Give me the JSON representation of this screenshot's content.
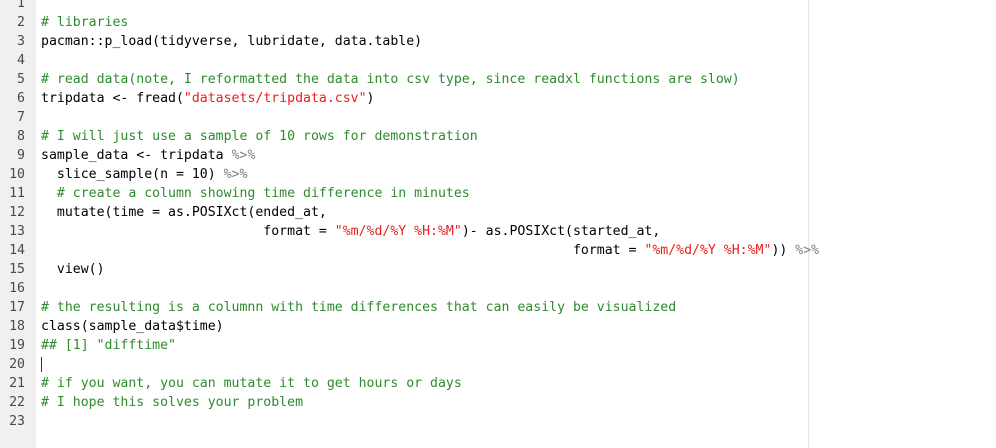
{
  "editor": {
    "language": "R",
    "colors": {
      "gutter_bg": "#f0f0f0",
      "comment": "#2e8b2e",
      "string": "#e8211c",
      "pipe": "#7f7f7f",
      "text": "#000000"
    },
    "lines": [
      {
        "n": "1",
        "tokens": []
      },
      {
        "n": "2",
        "tokens": [
          {
            "t": "# libraries",
            "c": "comment"
          }
        ]
      },
      {
        "n": "3",
        "tokens": [
          {
            "t": "pacman::p_load(tidyverse, lubridate, data.table)",
            "c": ""
          }
        ]
      },
      {
        "n": "4",
        "tokens": []
      },
      {
        "n": "5",
        "tokens": [
          {
            "t": "# read data(note, I reformatted the data into csv type, since readxl functions are slow)",
            "c": "comment"
          }
        ]
      },
      {
        "n": "6",
        "tokens": [
          {
            "t": "tripdata <- fread(",
            "c": ""
          },
          {
            "t": "\"datasets/tripdata.csv\"",
            "c": "str"
          },
          {
            "t": ")",
            "c": ""
          }
        ]
      },
      {
        "n": "7",
        "tokens": []
      },
      {
        "n": "8",
        "tokens": [
          {
            "t": "# I will just use a sample of 10 rows for demonstration",
            "c": "comment"
          }
        ]
      },
      {
        "n": "9",
        "tokens": [
          {
            "t": "sample_data <- tripdata ",
            "c": ""
          },
          {
            "t": "%>%",
            "c": "pipe"
          }
        ]
      },
      {
        "n": "10",
        "tokens": [
          {
            "t": "  slice_sample(n = 10) ",
            "c": ""
          },
          {
            "t": "%>%",
            "c": "pipe"
          }
        ]
      },
      {
        "n": "11",
        "tokens": [
          {
            "t": "  # create a column showing time difference in minutes",
            "c": "comment"
          }
        ]
      },
      {
        "n": "12",
        "tokens": [
          {
            "t": "  mutate(time = as.POSIXct(ended_at,",
            "c": ""
          }
        ]
      },
      {
        "n": "13",
        "tokens": [
          {
            "t": "                            format = ",
            "c": ""
          },
          {
            "t": "\"%m/%d/%Y %H:%M\"",
            "c": "str"
          },
          {
            "t": ")- as.POSIXct(started_at,",
            "c": ""
          }
        ]
      },
      {
        "n": "14",
        "tokens": [
          {
            "t": "                                                                   format = ",
            "c": ""
          },
          {
            "t": "\"%m/%d/%Y %H:%M\"",
            "c": "str"
          },
          {
            "t": ")) ",
            "c": ""
          },
          {
            "t": "%>%",
            "c": "pipe"
          }
        ]
      },
      {
        "n": "15",
        "tokens": [
          {
            "t": "  view()",
            "c": ""
          }
        ]
      },
      {
        "n": "16",
        "tokens": []
      },
      {
        "n": "17",
        "tokens": [
          {
            "t": "# the resulting is a columnn with time differences that can easily be visualized",
            "c": "comment"
          }
        ]
      },
      {
        "n": "18",
        "tokens": [
          {
            "t": "class(sample_data$time)",
            "c": ""
          }
        ]
      },
      {
        "n": "19",
        "tokens": [
          {
            "t": "## [1] \"difftime\"",
            "c": "comment"
          }
        ]
      },
      {
        "n": "20",
        "tokens": [],
        "cursor": true
      },
      {
        "n": "21",
        "tokens": [
          {
            "t": "# if you want, you can mutate it to get hours or days",
            "c": "comment"
          }
        ]
      },
      {
        "n": "22",
        "tokens": [
          {
            "t": "# I hope this solves your problem",
            "c": "comment"
          }
        ]
      },
      {
        "n": "23",
        "tokens": []
      }
    ]
  }
}
